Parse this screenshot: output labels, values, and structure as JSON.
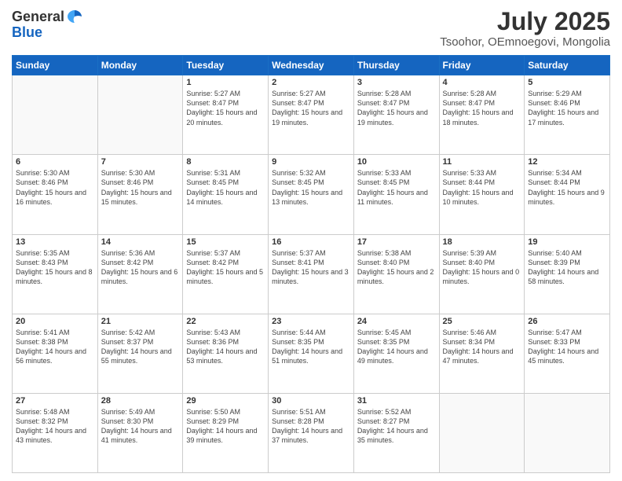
{
  "header": {
    "logo_general": "General",
    "logo_blue": "Blue",
    "title": "July 2025",
    "subtitle": "Tsoohor, OEmnoegovi, Mongolia"
  },
  "weekdays": [
    "Sunday",
    "Monday",
    "Tuesday",
    "Wednesday",
    "Thursday",
    "Friday",
    "Saturday"
  ],
  "weeks": [
    [
      {
        "day": "",
        "info": ""
      },
      {
        "day": "",
        "info": ""
      },
      {
        "day": "1",
        "sunrise": "5:27 AM",
        "sunset": "8:47 PM",
        "daylight": "15 hours and 20 minutes."
      },
      {
        "day": "2",
        "sunrise": "5:27 AM",
        "sunset": "8:47 PM",
        "daylight": "15 hours and 19 minutes."
      },
      {
        "day": "3",
        "sunrise": "5:28 AM",
        "sunset": "8:47 PM",
        "daylight": "15 hours and 19 minutes."
      },
      {
        "day": "4",
        "sunrise": "5:28 AM",
        "sunset": "8:47 PM",
        "daylight": "15 hours and 18 minutes."
      },
      {
        "day": "5",
        "sunrise": "5:29 AM",
        "sunset": "8:46 PM",
        "daylight": "15 hours and 17 minutes."
      }
    ],
    [
      {
        "day": "6",
        "sunrise": "5:30 AM",
        "sunset": "8:46 PM",
        "daylight": "15 hours and 16 minutes."
      },
      {
        "day": "7",
        "sunrise": "5:30 AM",
        "sunset": "8:46 PM",
        "daylight": "15 hours and 15 minutes."
      },
      {
        "day": "8",
        "sunrise": "5:31 AM",
        "sunset": "8:45 PM",
        "daylight": "15 hours and 14 minutes."
      },
      {
        "day": "9",
        "sunrise": "5:32 AM",
        "sunset": "8:45 PM",
        "daylight": "15 hours and 13 minutes."
      },
      {
        "day": "10",
        "sunrise": "5:33 AM",
        "sunset": "8:45 PM",
        "daylight": "15 hours and 11 minutes."
      },
      {
        "day": "11",
        "sunrise": "5:33 AM",
        "sunset": "8:44 PM",
        "daylight": "15 hours and 10 minutes."
      },
      {
        "day": "12",
        "sunrise": "5:34 AM",
        "sunset": "8:44 PM",
        "daylight": "15 hours and 9 minutes."
      }
    ],
    [
      {
        "day": "13",
        "sunrise": "5:35 AM",
        "sunset": "8:43 PM",
        "daylight": "15 hours and 8 minutes."
      },
      {
        "day": "14",
        "sunrise": "5:36 AM",
        "sunset": "8:42 PM",
        "daylight": "15 hours and 6 minutes."
      },
      {
        "day": "15",
        "sunrise": "5:37 AM",
        "sunset": "8:42 PM",
        "daylight": "15 hours and 5 minutes."
      },
      {
        "day": "16",
        "sunrise": "5:37 AM",
        "sunset": "8:41 PM",
        "daylight": "15 hours and 3 minutes."
      },
      {
        "day": "17",
        "sunrise": "5:38 AM",
        "sunset": "8:40 PM",
        "daylight": "15 hours and 2 minutes."
      },
      {
        "day": "18",
        "sunrise": "5:39 AM",
        "sunset": "8:40 PM",
        "daylight": "15 hours and 0 minutes."
      },
      {
        "day": "19",
        "sunrise": "5:40 AM",
        "sunset": "8:39 PM",
        "daylight": "14 hours and 58 minutes."
      }
    ],
    [
      {
        "day": "20",
        "sunrise": "5:41 AM",
        "sunset": "8:38 PM",
        "daylight": "14 hours and 56 minutes."
      },
      {
        "day": "21",
        "sunrise": "5:42 AM",
        "sunset": "8:37 PM",
        "daylight": "14 hours and 55 minutes."
      },
      {
        "day": "22",
        "sunrise": "5:43 AM",
        "sunset": "8:36 PM",
        "daylight": "14 hours and 53 minutes."
      },
      {
        "day": "23",
        "sunrise": "5:44 AM",
        "sunset": "8:35 PM",
        "daylight": "14 hours and 51 minutes."
      },
      {
        "day": "24",
        "sunrise": "5:45 AM",
        "sunset": "8:35 PM",
        "daylight": "14 hours and 49 minutes."
      },
      {
        "day": "25",
        "sunrise": "5:46 AM",
        "sunset": "8:34 PM",
        "daylight": "14 hours and 47 minutes."
      },
      {
        "day": "26",
        "sunrise": "5:47 AM",
        "sunset": "8:33 PM",
        "daylight": "14 hours and 45 minutes."
      }
    ],
    [
      {
        "day": "27",
        "sunrise": "5:48 AM",
        "sunset": "8:32 PM",
        "daylight": "14 hours and 43 minutes."
      },
      {
        "day": "28",
        "sunrise": "5:49 AM",
        "sunset": "8:30 PM",
        "daylight": "14 hours and 41 minutes."
      },
      {
        "day": "29",
        "sunrise": "5:50 AM",
        "sunset": "8:29 PM",
        "daylight": "14 hours and 39 minutes."
      },
      {
        "day": "30",
        "sunrise": "5:51 AM",
        "sunset": "8:28 PM",
        "daylight": "14 hours and 37 minutes."
      },
      {
        "day": "31",
        "sunrise": "5:52 AM",
        "sunset": "8:27 PM",
        "daylight": "14 hours and 35 minutes."
      },
      {
        "day": "",
        "info": ""
      },
      {
        "day": "",
        "info": ""
      }
    ]
  ]
}
